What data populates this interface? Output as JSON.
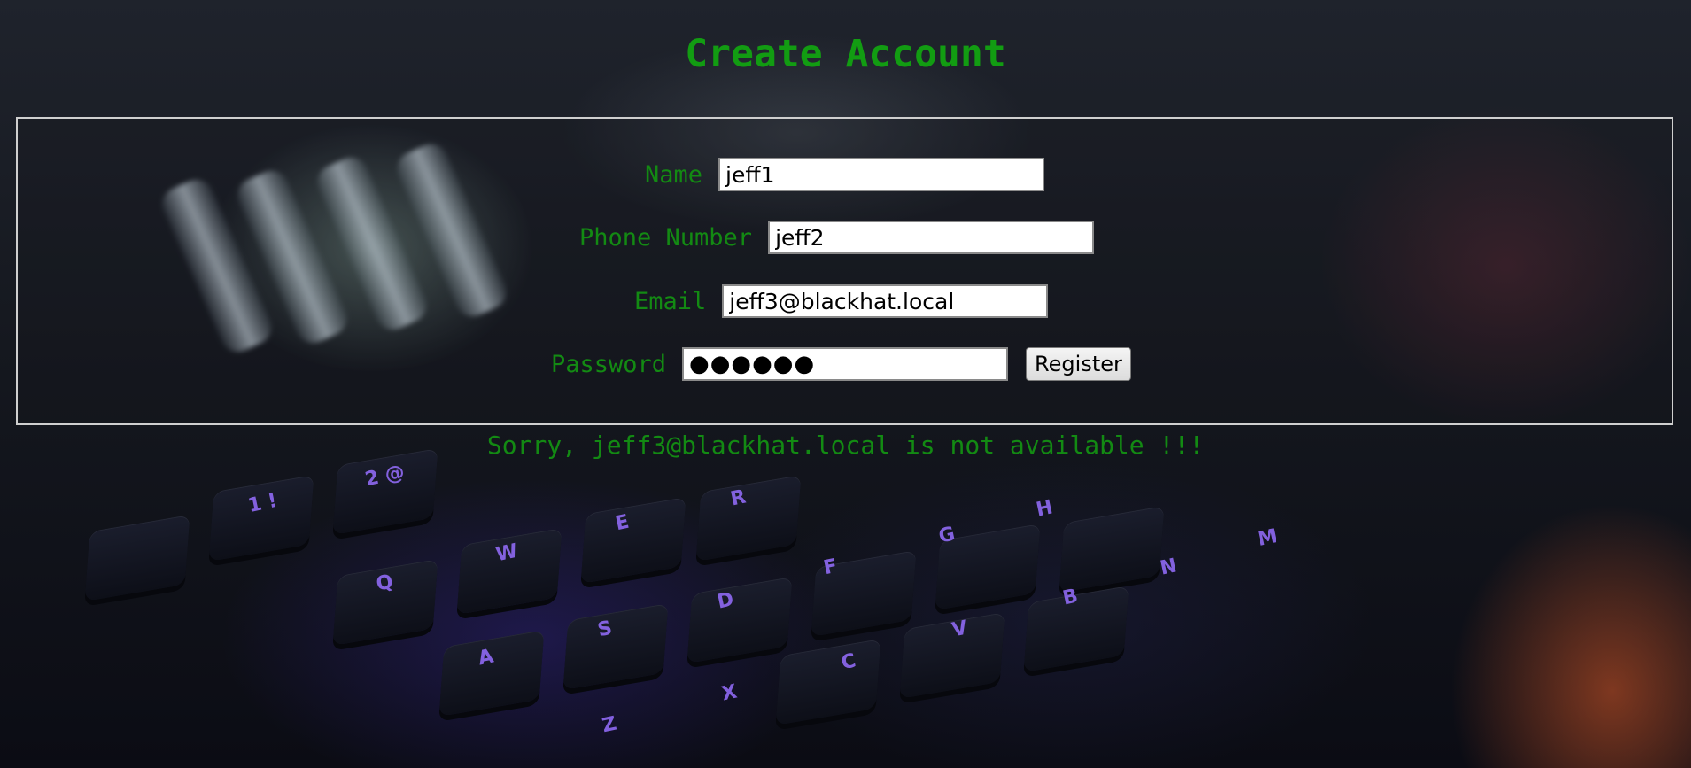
{
  "page": {
    "title": "Create Account"
  },
  "form": {
    "name_label": "Name",
    "name_value": "jeff1",
    "phone_label": "Phone Number",
    "phone_value": "jeff2",
    "email_label": "Email",
    "email_value": "jeff3@blackhat.local",
    "password_label": "Password",
    "password_display": "●●●●●●",
    "register_label": "Register"
  },
  "message": {
    "text": "Sorry, jeff3@blackhat.local is not available !!!"
  },
  "background": {
    "key_glyphs": [
      "1 !",
      "2 @",
      "Q",
      "W",
      "E",
      "R",
      "A",
      "S",
      "D",
      "F",
      "G",
      "H",
      "Z",
      "X",
      "C",
      "V",
      "B",
      "N",
      "M"
    ]
  },
  "colors": {
    "accent_green": "#129c12",
    "form_border": "#cfcfcf"
  }
}
